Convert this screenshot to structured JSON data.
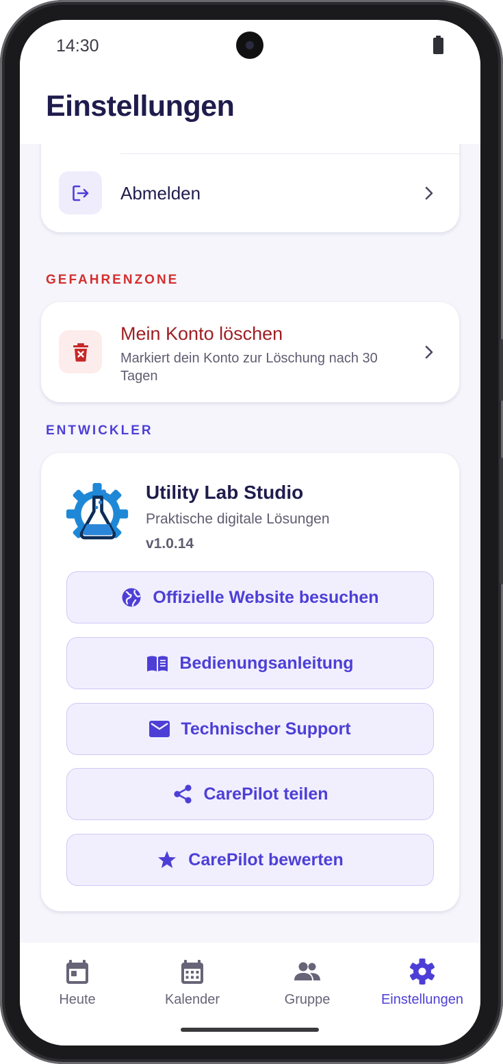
{
  "status_bar": {
    "time": "14:30"
  },
  "header": {
    "title": "Einstellungen"
  },
  "account_card": {
    "logout": {
      "label": "Abmelden",
      "icon": "logout-icon"
    }
  },
  "danger_zone": {
    "section_label": "GEFAHRENZONE",
    "delete_account": {
      "title": "Mein Konto löschen",
      "subtitle": "Markiert dein Konto zur Löschung nach 30 Tagen",
      "icon": "delete-icon"
    }
  },
  "developer": {
    "section_label": "ENTWICKLER",
    "name": "Utility Lab Studio",
    "tagline": "Praktische digitale Lösungen",
    "version": "v1.0.14",
    "buttons": [
      {
        "label": "Offizielle Website besuchen",
        "icon": "globe-icon"
      },
      {
        "label": "Bedienungsanleitung",
        "icon": "book-icon"
      },
      {
        "label": "Technischer Support",
        "icon": "mail-icon"
      },
      {
        "label": "CarePilot teilen",
        "icon": "share-icon"
      },
      {
        "label": "CarePilot bewerten",
        "icon": "star-icon"
      }
    ]
  },
  "bottom_nav": {
    "items": [
      {
        "label": "Heute",
        "icon": "today-icon",
        "active": false
      },
      {
        "label": "Kalender",
        "icon": "calendar-icon",
        "active": false
      },
      {
        "label": "Gruppe",
        "icon": "group-icon",
        "active": false
      },
      {
        "label": "Einstellungen",
        "icon": "settings-icon",
        "active": true
      }
    ]
  },
  "colors": {
    "accent": "#4d3fd6",
    "title_text": "#1f1c4d",
    "danger": "#d32f2f",
    "danger_text": "#9e1f24",
    "background": "#f5f5fb",
    "button_fill": "#f1effe"
  }
}
